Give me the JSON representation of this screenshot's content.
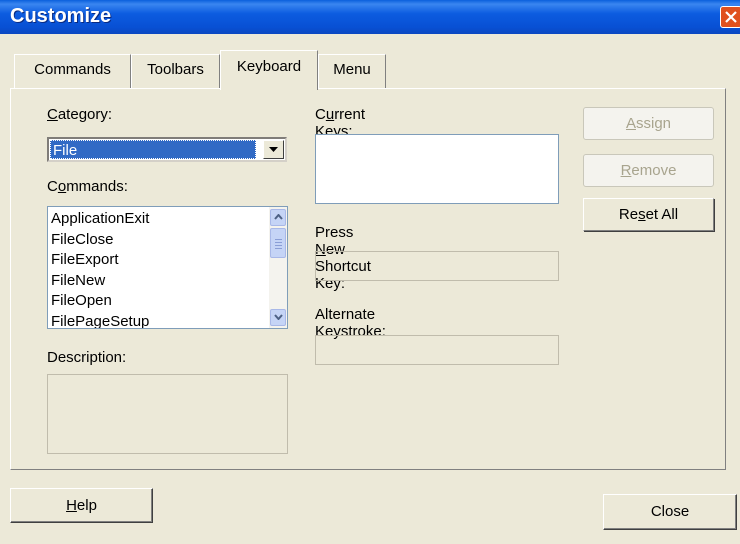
{
  "window": {
    "title": "Customize"
  },
  "tabs": [
    {
      "label": "Commands",
      "active": false
    },
    {
      "label": "Toolbars",
      "active": false
    },
    {
      "label": "Keyboard",
      "active": true
    },
    {
      "label": "Menu",
      "active": false
    }
  ],
  "category": {
    "label_pre": "",
    "label_u": "C",
    "label_post": "ategory:",
    "value": "File"
  },
  "commands": {
    "label_pre": "C",
    "label_u": "o",
    "label_post": "mmands:",
    "items": [
      "ApplicationExit",
      "FileClose",
      "FileExport",
      "FileNew",
      "FileOpen",
      "FilePageSetup"
    ]
  },
  "description": {
    "label": "Description:"
  },
  "current_keys": {
    "label_pre": "C",
    "label_u": "u",
    "label_post": "rrent Keys:"
  },
  "shortcut": {
    "label_pre": "Press ",
    "label_u": "N",
    "label_post": "ew Shortcut Key:",
    "value": ""
  },
  "alternate": {
    "label": "Alternate Keystroke:",
    "value": ""
  },
  "buttons": {
    "assign": {
      "pre": "",
      "u": "A",
      "post": "ssign",
      "enabled": false
    },
    "remove": {
      "pre": "",
      "u": "R",
      "post": "emove",
      "enabled": false
    },
    "reset_all": {
      "pre": "Re",
      "u": "s",
      "post": "et All",
      "enabled": true
    },
    "help": {
      "pre": "",
      "u": "H",
      "post": "elp"
    },
    "close": {
      "label": "Close"
    }
  }
}
